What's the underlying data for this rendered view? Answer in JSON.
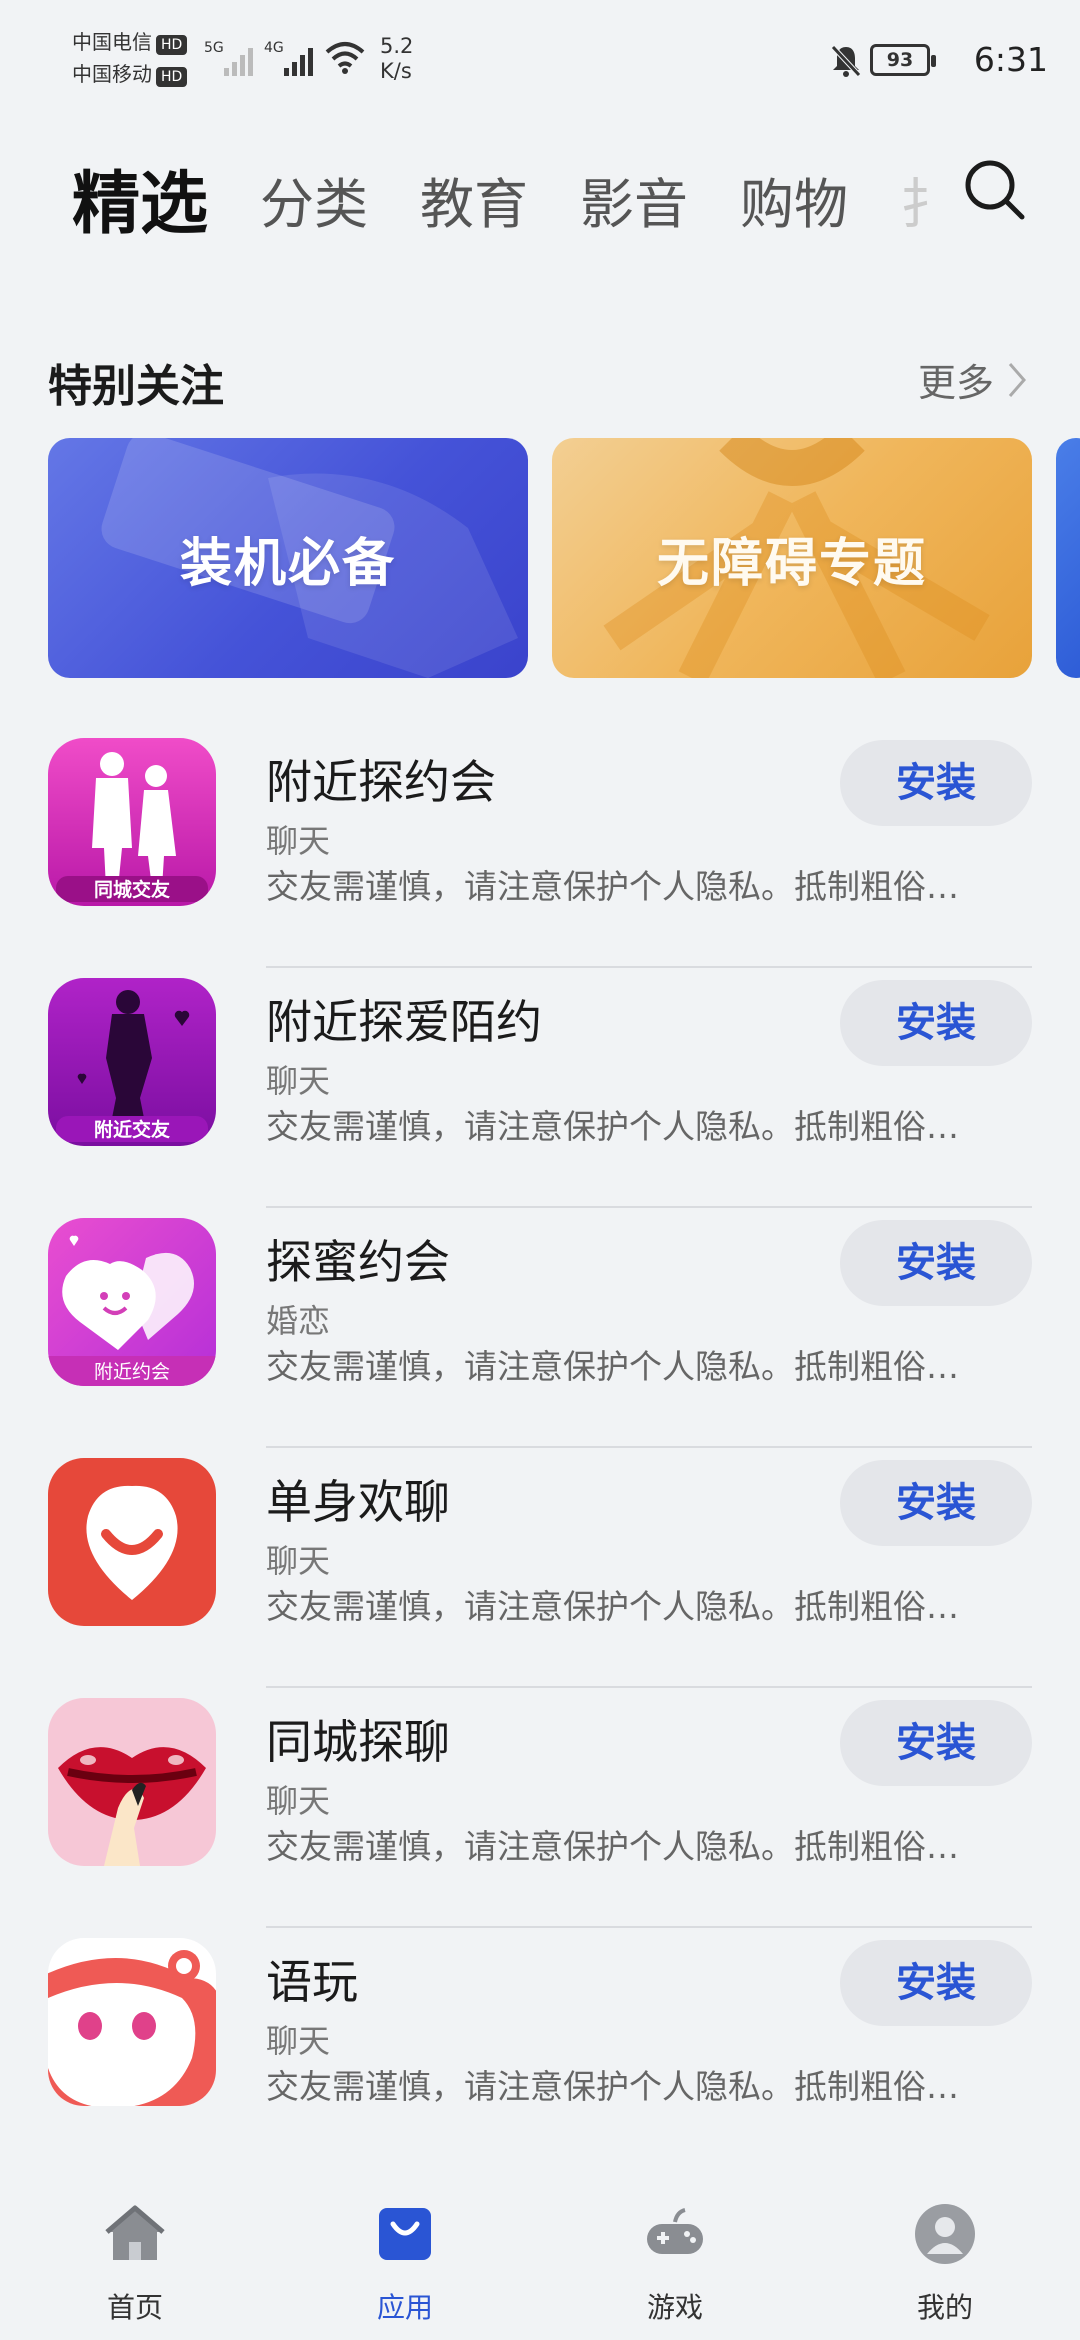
{
  "status_bar": {
    "carrier1": "中国电信",
    "carrier2": "中国移动",
    "hd": "HD",
    "sig1_label": "5G",
    "sig2_label": "4G",
    "net_speed_value": "5.2",
    "net_speed_unit": "K/s",
    "battery": "93",
    "time": "6:31"
  },
  "tabs": [
    "精选",
    "分类",
    "教育",
    "影音",
    "购物",
    "扌"
  ],
  "section": {
    "title": "特别关注",
    "more": "更多"
  },
  "banners": [
    {
      "label": "装机必备"
    },
    {
      "label": "无障碍专题"
    }
  ],
  "apps": [
    {
      "name": "附近探约会",
      "category": "聊天",
      "desc": "交友需谨慎，请注意保护个人隐私。抵制粗俗…",
      "install": "安装",
      "badge": "同城交友"
    },
    {
      "name": "附近探爱陌约",
      "category": "聊天",
      "desc": "交友需谨慎，请注意保护个人隐私。抵制粗俗…",
      "install": "安装",
      "badge": "附近交友"
    },
    {
      "name": "探蜜约会",
      "category": "婚恋",
      "desc": "交友需谨慎，请注意保护个人隐私。抵制粗俗…",
      "install": "安装",
      "badge": "附近约会"
    },
    {
      "name": "单身欢聊",
      "category": "聊天",
      "desc": "交友需谨慎，请注意保护个人隐私。抵制粗俗…",
      "install": "安装"
    },
    {
      "name": "同城探聊",
      "category": "聊天",
      "desc": "交友需谨慎，请注意保护个人隐私。抵制粗俗…",
      "install": "安装"
    },
    {
      "name": "语玩",
      "category": "聊天",
      "desc": "交友需谨慎，请注意保护个人隐私。抵制粗俗…",
      "install": "安装"
    }
  ],
  "bottom_nav": [
    {
      "label": "首页",
      "icon": "home-icon"
    },
    {
      "label": "应用",
      "icon": "apps-bag-icon"
    },
    {
      "label": "游戏",
      "icon": "gamepad-icon"
    },
    {
      "label": "我的",
      "icon": "profile-icon"
    }
  ],
  "colors": {
    "accent": "#2a55d4",
    "background": "#f1f3f5",
    "install_bg": "#e4e6ea"
  }
}
